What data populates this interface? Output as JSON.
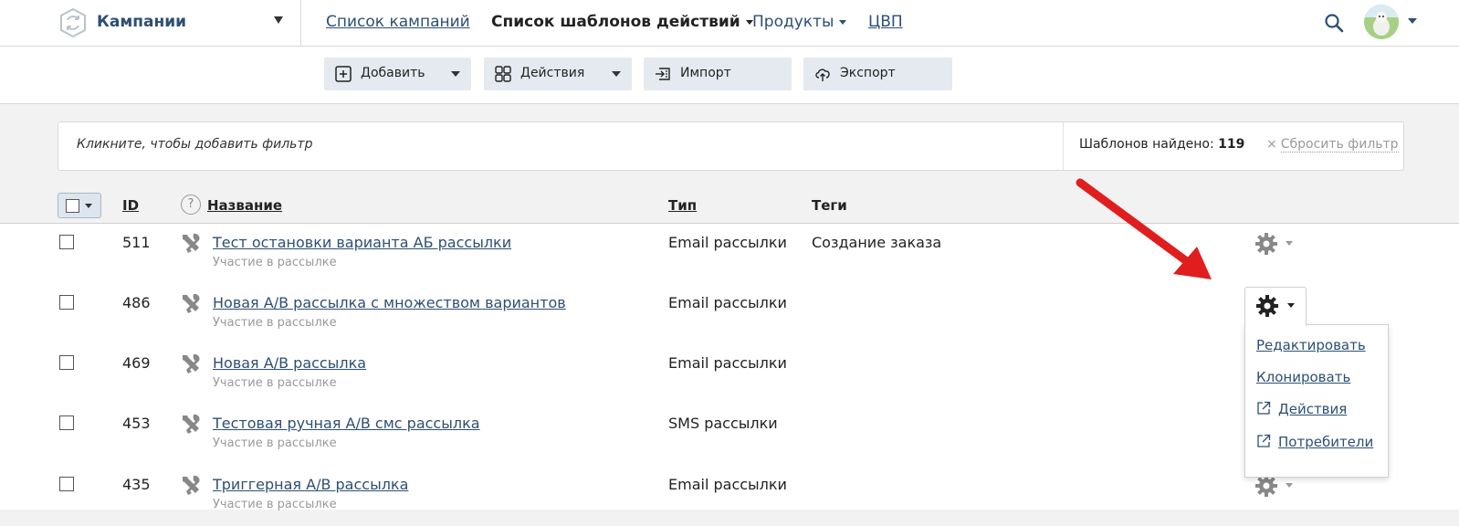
{
  "header": {
    "app_title": "Кампании",
    "nav": [
      {
        "label": "Список кампаний"
      },
      {
        "label": "Список шаблонов действий"
      },
      {
        "label": "Продукты"
      },
      {
        "label": "ЦВП"
      }
    ]
  },
  "toolbar": {
    "add_label": "Добавить",
    "actions_label": "Действия",
    "import_label": "Импорт",
    "export_label": "Экспорт"
  },
  "filter": {
    "hint": "Кликните, чтобы добавить фильтр",
    "count_label": "Шаблонов найдено:",
    "count_value": "119",
    "reset_symbol": "×",
    "reset_label": "Сбросить фильтр"
  },
  "table": {
    "headers": {
      "id": "ID",
      "help": "?",
      "name": "Название",
      "type": "Тип",
      "tags": "Теги"
    },
    "rows": [
      {
        "id": "511",
        "name": "Тест остановки варианта АБ рассылки",
        "subtitle": "Участие в рассылке",
        "type": "Email рассылки",
        "tags": "Создание заказа"
      },
      {
        "id": "486",
        "name": "Новая A/B рассылка с множеством вариантов",
        "subtitle": "Участие в рассылке",
        "type": "Email рассылки",
        "tags": ""
      },
      {
        "id": "469",
        "name": "Новая A/B рассылка",
        "subtitle": "Участие в рассылке",
        "type": "Email рассылки",
        "tags": ""
      },
      {
        "id": "453",
        "name": "Тестовая ручная A/B смс рассылка",
        "subtitle": "Участие в рассылке",
        "type": "SMS рассылки",
        "tags": ""
      },
      {
        "id": "435",
        "name": "Триггерная A/B рассылка",
        "subtitle": "Участие в рассылке",
        "type": "Email рассылки",
        "tags": ""
      }
    ]
  },
  "row_menu": {
    "items": [
      {
        "label": "Редактировать",
        "icon": "none"
      },
      {
        "label": "Клонировать",
        "icon": "none"
      },
      {
        "label": "Действия",
        "icon": "external-link-icon"
      },
      {
        "label": "Потребители",
        "icon": "external-link-icon"
      }
    ]
  },
  "colors": {
    "link": "#2d4f73",
    "toolbar_button": "#e4eaef",
    "annotation_arrow": "#e01e1e"
  }
}
